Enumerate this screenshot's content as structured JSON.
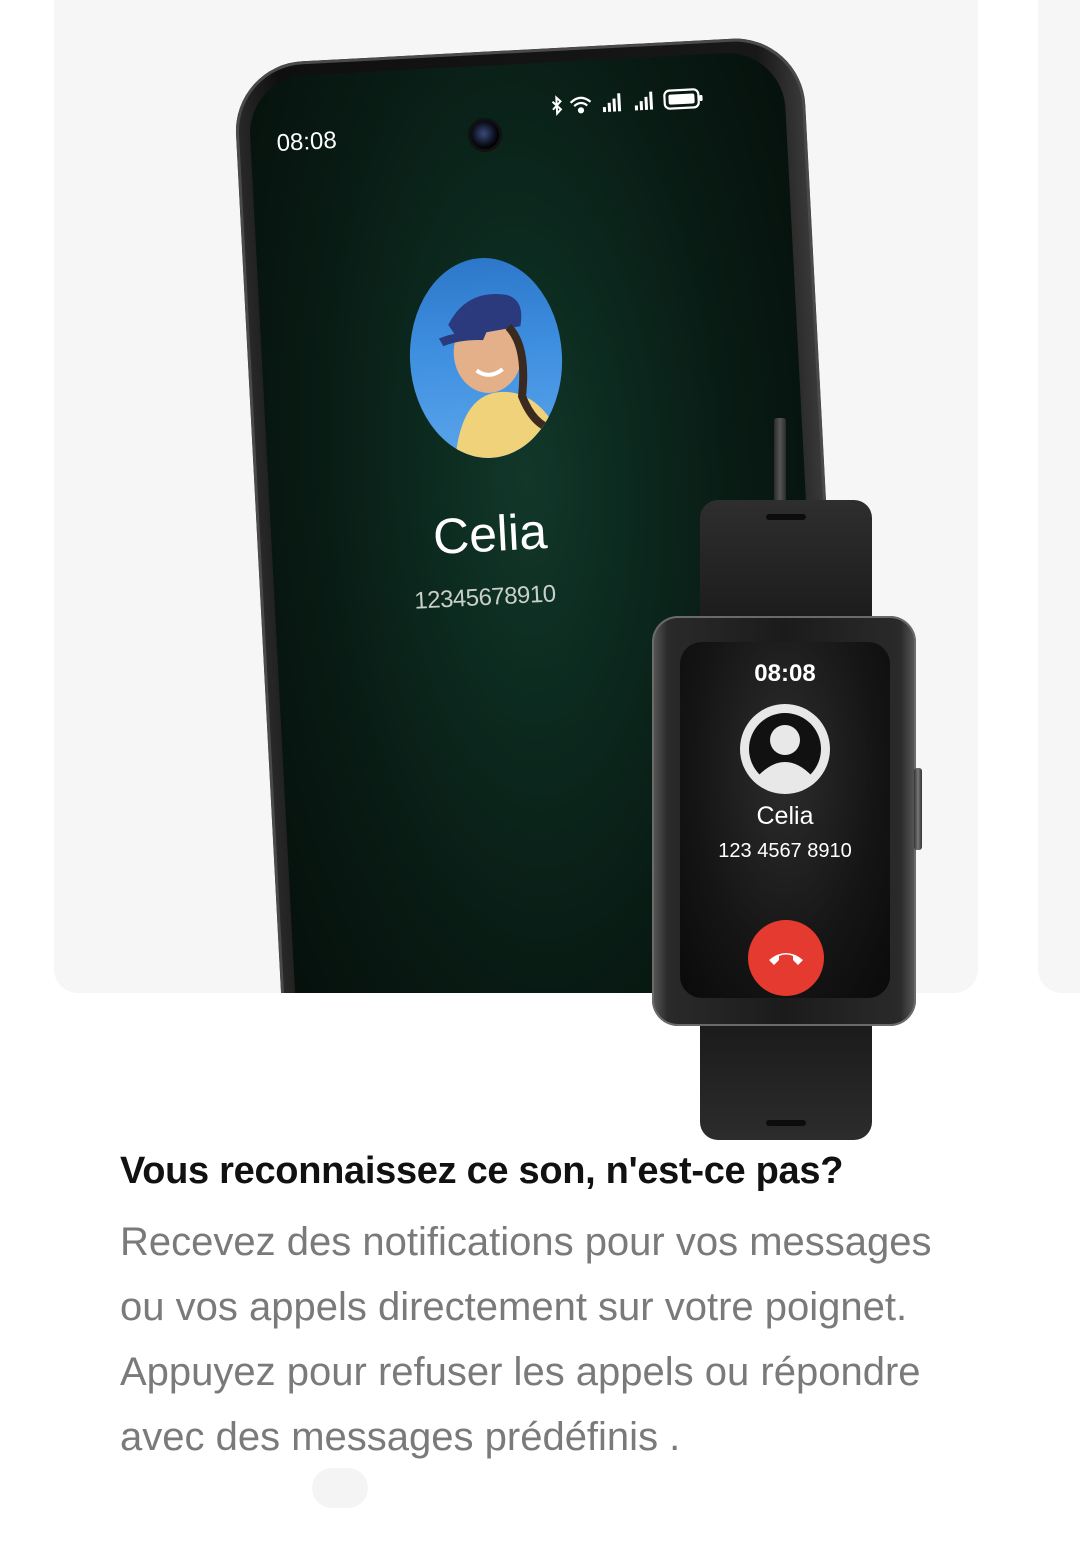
{
  "phone": {
    "status_time": "08:08",
    "caller_name": "Celia",
    "caller_number": "12345678910"
  },
  "watch": {
    "time": "08:08",
    "caller_name": "Celia",
    "caller_number": "123 4567 8910"
  },
  "feature": {
    "title": "Vous reconnaissez ce son, n'est-ce pas?",
    "description": "Recevez des notifications pour vos messages ou vos appels directement sur votre poignet. Appuyez pour refuser les appels ou répondre avec des messages prédéfinis ."
  },
  "colors": {
    "card_background": "#f6f6f6",
    "decline_button": "#e53a2f",
    "title_text": "#111111",
    "body_text": "#7a7a7a"
  }
}
